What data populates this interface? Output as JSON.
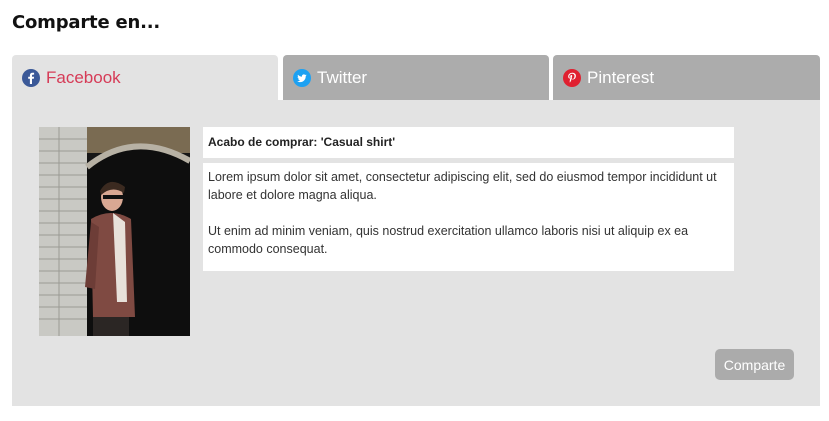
{
  "page": {
    "title": "Comparte en..."
  },
  "tabs": [
    {
      "label": "Facebook",
      "icon": "facebook-icon",
      "active": true,
      "icon_color": "#3b5998"
    },
    {
      "label": "Twitter",
      "icon": "twitter-icon",
      "active": false,
      "icon_color": "#1da1f2"
    },
    {
      "label": "Pinterest",
      "icon": "pinterest-icon",
      "active": false,
      "icon_color": "#e02030"
    }
  ],
  "post": {
    "title": "Acabo de comprar: 'Casual shirt'",
    "paragraphs": [
      "Lorem ipsum dolor sit amet, consectetur adipiscing elit, sed do eiusmod tempor incididunt ut labore et dolore magna aliqua.",
      "Ut enim ad minim veniam, quis nostrud exercitation ullamco laboris nisi ut aliquip ex ea commodo consequat."
    ]
  },
  "share_button": {
    "label": "Comparte"
  },
  "colors": {
    "active_tab_text": "#d63b57",
    "inactive_tab_bg": "#acacac",
    "panel_bg": "#e3e3e3",
    "button_bg": "#ababab"
  }
}
